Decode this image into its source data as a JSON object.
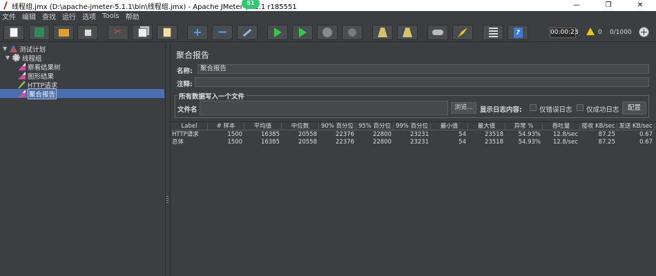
{
  "window": {
    "title": "线程组.jmx (D:\\apache-jmeter-5.1.1\\bin\\线程组.jmx) - Apache JMeter (5.1.1 r185551",
    "badge": "51",
    "controls": [
      "—",
      "❐",
      "✕"
    ]
  },
  "menu": [
    "文件",
    "编辑",
    "查找",
    "运行",
    "选项",
    "Tools",
    "帮助"
  ],
  "toolbar": {
    "buttons": [
      "new-icon",
      "templates-icon",
      "open-icon",
      "save-icon",
      "cut-icon",
      "copy-icon",
      "paste-icon",
      "expand-icon",
      "collapse-icon",
      "toggle-icon",
      "start-icon",
      "start-no-pause-icon",
      "stop-icon",
      "shutdown-icon",
      "clear-icon",
      "clear-all-icon",
      "search-icon",
      "reset-search-icon",
      "function-helper-icon",
      "help-icon"
    ],
    "timer": "00:00:23",
    "warnings": "0",
    "threads": "0/1000"
  },
  "tree": {
    "items": [
      {
        "label": "测试计划",
        "arrow": "▼",
        "icon": "test-plan-icon"
      },
      {
        "label": "线程组",
        "arrow": "▼",
        "icon": "thread-group-icon"
      },
      {
        "label": "察看结果树",
        "icon": "listener-icon"
      },
      {
        "label": "图形结果",
        "icon": "listener-icon"
      },
      {
        "label": "HTTP请求",
        "icon": "sampler-icon"
      },
      {
        "label": "聚合报告",
        "icon": "listener-icon",
        "selected": true
      }
    ]
  },
  "panel": {
    "title": "聚合报告",
    "name_label": "名称:",
    "name_value": "聚合报告",
    "comment_label": "注释:",
    "comment_value": "",
    "fieldset_legend": "所有数据写入一个文件",
    "filename_label": "文件名",
    "filename_value": "",
    "browse_label": "浏览...",
    "log_label": "显示日志内容:",
    "errors_only": "仅错误日志",
    "success_only": "仅成功日志",
    "configure": "配置"
  },
  "table": {
    "columns": [
      "Label",
      "# 样本",
      "平均值",
      "中位数",
      "90% 百分位",
      "95% 百分位",
      "99% 百分位",
      "最小值",
      "最大值",
      "异常 %",
      "吞吐量",
      "接收 KB/sec",
      "发送 KB/sec"
    ],
    "rows": [
      [
        "HTTP请求",
        "1500",
        "16385",
        "20558",
        "22376",
        "22800",
        "23231",
        "54",
        "23518",
        "54.93%",
        "12.8/sec",
        "87.25",
        "0.67"
      ],
      [
        "总体",
        "1500",
        "16385",
        "20558",
        "22376",
        "22800",
        "23231",
        "54",
        "23518",
        "54.93%",
        "12.8/sec",
        "87.25",
        "0.67"
      ]
    ]
  }
}
